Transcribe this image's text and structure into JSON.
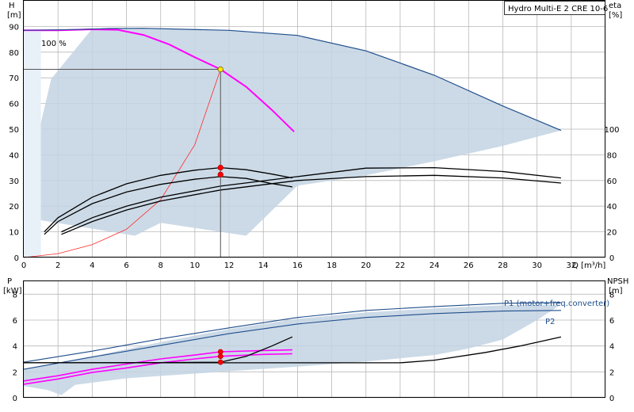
{
  "chart_data": [
    {
      "type": "line",
      "title": "Hydro Multi-E 2 CRE 10-6",
      "xlabel": "Q [m³/h]",
      "ylabel_top": "H",
      "ylabel_unit": "[m]",
      "y2label_top": "eta",
      "y2label_unit": "[%]",
      "xlim": [
        0,
        34
      ],
      "ylim": [
        0,
        100
      ],
      "y2lim": [
        0,
        200
      ],
      "grid": true,
      "x_ticks": [
        0,
        2,
        4,
        6,
        8,
        10,
        12,
        14,
        16,
        18,
        20,
        22,
        24,
        26,
        28,
        30,
        32
      ],
      "y_ticks": [
        0,
        10,
        20,
        30,
        40,
        50,
        60,
        70,
        80,
        90
      ],
      "y2_ticks": [
        0,
        20,
        40,
        60,
        80,
        100
      ],
      "annotation": "100 %",
      "operating_range": [
        [
          1,
          52.5
        ],
        [
          1.6,
          69.5
        ],
        [
          4,
          89.2
        ],
        [
          7,
          89.3
        ],
        [
          12,
          88.5
        ],
        [
          16,
          86.5
        ],
        [
          20,
          80.5
        ],
        [
          24,
          71
        ],
        [
          28,
          59
        ],
        [
          31.4,
          49.5
        ],
        [
          28,
          43.5
        ],
        [
          24,
          37.5
        ],
        [
          20,
          32
        ],
        [
          16,
          28
        ],
        [
          13,
          8.5
        ],
        [
          8,
          13.5
        ],
        [
          6.5,
          8.5
        ],
        [
          1,
          14.5
        ],
        [
          0.5,
          14.5
        ],
        [
          0.3,
          47
        ]
      ],
      "series": [
        {
          "name": "",
          "axis": "y",
          "color": "#ff00ff",
          "points": [
            [
              0,
              88.5
            ],
            [
              2,
              88.5
            ],
            [
              4,
              88.9
            ],
            [
              5.5,
              88.7
            ],
            [
              7,
              86.7
            ],
            [
              8.5,
              83
            ],
            [
              10,
              78
            ],
            [
              11.5,
              73.3
            ],
            [
              13,
              66.5
            ],
            [
              14.5,
              57.5
            ],
            [
              15.8,
              49
            ]
          ]
        },
        {
          "name": "",
          "axis": "y",
          "color": "#1f4e8c",
          "points": [
            [
              0,
              88.5
            ],
            [
              3,
              88.8
            ],
            [
              5,
              89.2
            ],
            [
              7,
              89.3
            ],
            [
              12,
              88.5
            ],
            [
              16,
              86.5
            ],
            [
              20,
              80.5
            ],
            [
              24,
              71
            ],
            [
              28,
              59
            ],
            [
              31.4,
              49.5
            ]
          ]
        },
        {
          "name": "",
          "axis": "y",
          "color": "#ff2a2a",
          "points": [
            [
              0,
              0
            ],
            [
              2,
              1.5
            ],
            [
              4,
              5
            ],
            [
              6,
              11
            ],
            [
              8,
              22.5
            ],
            [
              10,
              44
            ],
            [
              11.5,
              73.3
            ]
          ]
        },
        {
          "name": "",
          "axis": "y",
          "color": "#000000",
          "points": [
            [
              1.2,
              9
            ],
            [
              2,
              14
            ],
            [
              4,
              21
            ],
            [
              6,
              25.5
            ],
            [
              8,
              28.5
            ],
            [
              10,
              30.5
            ],
            [
              11.5,
              31.5
            ],
            [
              13,
              30.8
            ],
            [
              14.5,
              28.8
            ],
            [
              15.7,
              27.5
            ]
          ]
        },
        {
          "name": "",
          "axis": "y",
          "color": "#000000",
          "points": [
            [
              1.2,
              10
            ],
            [
              2,
              15.5
            ],
            [
              4,
              23.5
            ],
            [
              6,
              28.7
            ],
            [
              8,
              32
            ],
            [
              10,
              34
            ],
            [
              11.5,
              35
            ],
            [
              13,
              34.2
            ],
            [
              14.5,
              32.5
            ],
            [
              15.7,
              31
            ]
          ]
        },
        {
          "name": "",
          "axis": "y",
          "color": "#000000",
          "points": [
            [
              2.2,
              9
            ],
            [
              4,
              14
            ],
            [
              6,
              18.5
            ],
            [
              8,
              22
            ],
            [
              11.5,
              26.3
            ],
            [
              16,
              30
            ],
            [
              20,
              31.5
            ],
            [
              24,
              32
            ],
            [
              28,
              31
            ],
            [
              31.4,
              29
            ]
          ]
        },
        {
          "name": "",
          "axis": "y",
          "color": "#000000",
          "points": [
            [
              2.2,
              10
            ],
            [
              4,
              15.5
            ],
            [
              6,
              20
            ],
            [
              8,
              23.5
            ],
            [
              11.5,
              27.8
            ],
            [
              16,
              31.5
            ],
            [
              20,
              34.8
            ],
            [
              24,
              35
            ],
            [
              28,
              33.5
            ],
            [
              31.4,
              31
            ]
          ]
        }
      ],
      "markers": [
        {
          "color": "#ffee00",
          "x": 11.5,
          "y": 73.3
        },
        {
          "color": "#ff0000",
          "x": 11.5,
          "y": 35
        },
        {
          "color": "#ff0000",
          "x": 11.5,
          "y": 32.3
        }
      ]
    },
    {
      "type": "line",
      "ylabel_top": "P",
      "ylabel_unit": "[kW]",
      "y2label_top": "NPSH",
      "y2label_unit": "[m]",
      "xlim": [
        0,
        34
      ],
      "ylim": [
        0,
        9
      ],
      "grid": true,
      "y_ticks": [
        0,
        2,
        4,
        6,
        8
      ],
      "y2_ticks": [
        0,
        2,
        4,
        6,
        8
      ],
      "operating_range": [
        [
          0,
          2.2
        ],
        [
          4,
          3.2
        ],
        [
          8,
          4.3
        ],
        [
          12,
          5.3
        ],
        [
          16,
          6.1
        ],
        [
          20,
          6.6
        ],
        [
          24,
          6.9
        ],
        [
          28,
          7.15
        ],
        [
          31.4,
          7.2
        ],
        [
          30,
          6
        ],
        [
          28,
          4.5
        ],
        [
          26,
          3.8
        ],
        [
          24,
          3.3
        ],
        [
          20,
          2.8
        ],
        [
          16,
          2.4
        ],
        [
          12,
          2.05
        ],
        [
          6,
          1.5
        ],
        [
          3,
          1
        ],
        [
          2.2,
          0.2
        ],
        [
          1.4,
          0.6
        ],
        [
          0,
          0.9
        ]
      ],
      "series": [
        {
          "name": "P1 (motor+freq.converter)",
          "axis": "y",
          "color": "#1f4e8c",
          "points": [
            [
              0,
              2.75
            ],
            [
              4,
              3.6
            ],
            [
              8,
              4.55
            ],
            [
              12,
              5.4
            ],
            [
              16,
              6.2
            ],
            [
              20,
              6.75
            ],
            [
              24,
              7.05
            ],
            [
              28,
              7.3
            ],
            [
              31.4,
              7.35
            ]
          ]
        },
        {
          "name": "P2",
          "axis": "y",
          "color": "#1f4e8c",
          "points": [
            [
              0,
              2.2
            ],
            [
              4,
              3.15
            ],
            [
              8,
              4.05
            ],
            [
              12,
              4.95
            ],
            [
              16,
              5.7
            ],
            [
              20,
              6.2
            ],
            [
              24,
              6.5
            ],
            [
              28,
              6.7
            ],
            [
              31.4,
              6.75
            ]
          ]
        },
        {
          "name": "",
          "axis": "y",
          "color": "#ff00ff",
          "points": [
            [
              0,
              1.3
            ],
            [
              2,
              1.7
            ],
            [
              4,
              2.2
            ],
            [
              6,
              2.6
            ],
            [
              8,
              3
            ],
            [
              10,
              3.3
            ],
            [
              11.5,
              3.55
            ],
            [
              14,
              3.65
            ],
            [
              15.7,
              3.7
            ]
          ]
        },
        {
          "name": "",
          "axis": "y",
          "color": "#ff00ff",
          "points": [
            [
              0,
              1.05
            ],
            [
              2,
              1.45
            ],
            [
              4,
              1.95
            ],
            [
              6,
              2.3
            ],
            [
              8,
              2.7
            ],
            [
              10,
              3
            ],
            [
              11.5,
              3.2
            ],
            [
              14,
              3.35
            ],
            [
              15.7,
              3.4
            ]
          ]
        },
        {
          "name": "",
          "axis": "y",
          "color": "#000000",
          "points": [
            [
              0,
              2.7
            ],
            [
              8,
              2.72
            ],
            [
              11.5,
              2.75
            ],
            [
              13,
              3.2
            ],
            [
              14.5,
              4
            ],
            [
              15.7,
              4.7
            ]
          ]
        },
        {
          "name": "",
          "axis": "y",
          "color": "#000000",
          "points": [
            [
              0,
              2.7
            ],
            [
              10,
              2.7
            ],
            [
              16,
              2.7
            ],
            [
              20,
              2.7
            ],
            [
              22,
              2.7
            ],
            [
              24,
              2.9
            ],
            [
              27,
              3.5
            ],
            [
              29,
              4
            ],
            [
              31.4,
              4.7
            ]
          ]
        }
      ],
      "markers": [
        {
          "color": "#ff0000",
          "x": 11.5,
          "y": 3.55
        },
        {
          "color": "#ff0000",
          "x": 11.5,
          "y": 3.2
        },
        {
          "color": "#ff0000",
          "x": 11.5,
          "y": 2.75
        }
      ]
    }
  ]
}
